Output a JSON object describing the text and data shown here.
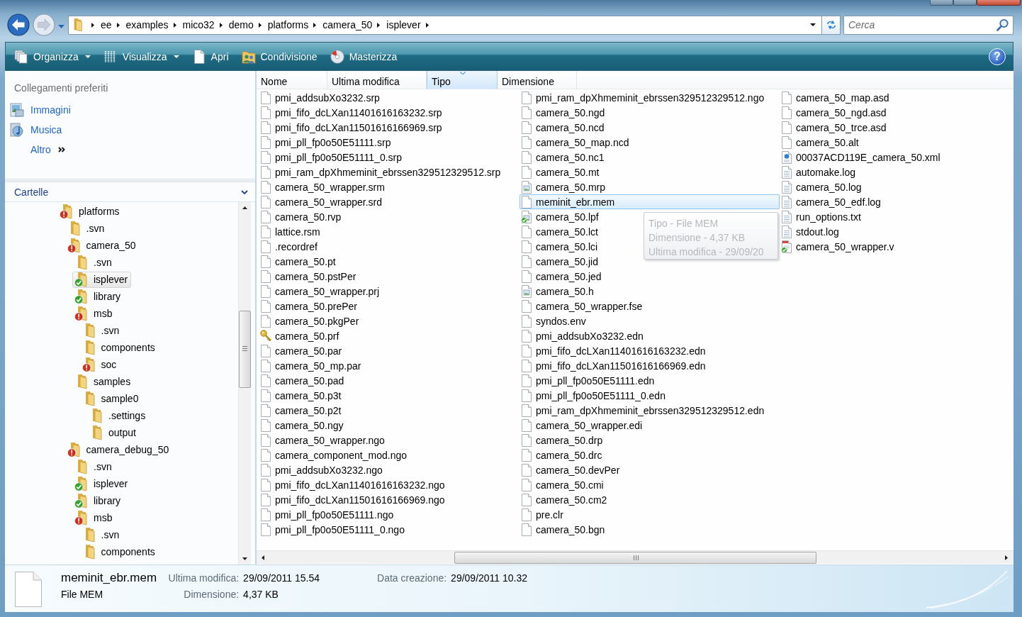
{
  "navigation": {
    "back": {
      "disabled": false
    },
    "forward": {
      "disabled": true
    },
    "breadcrumbs": [
      "ee",
      "examples",
      "mico32",
      "demo",
      "platforms",
      "camera_50",
      "isplever"
    ]
  },
  "search": {
    "placeholder": "Cerca"
  },
  "toolbar": {
    "items": [
      {
        "label": "Organizza",
        "kind": "menu"
      },
      {
        "label": "Visualizza",
        "kind": "menu"
      },
      {
        "label": "Apri",
        "kind": "button"
      },
      {
        "label": "Condivisione",
        "kind": "button"
      },
      {
        "label": "Masterizza",
        "kind": "button"
      }
    ],
    "help": "?"
  },
  "favorites": {
    "title": "Collegamenti preferiti",
    "links": [
      {
        "label": "Immagini",
        "kind": "link"
      },
      {
        "label": "Musica",
        "kind": "link"
      },
      {
        "label": "Altro",
        "kind": "more"
      }
    ]
  },
  "folders": {
    "title": "Cartelle",
    "tree": [
      {
        "name": "platforms",
        "kind": "conflict",
        "selected": false,
        "children": [
          {
            "name": ".svn",
            "kind": "plain",
            "selected": false
          },
          {
            "name": "camera_50",
            "kind": "conflict",
            "selected": false,
            "children": [
              {
                "name": ".svn",
                "kind": "plain",
                "selected": false
              },
              {
                "name": "isplever",
                "kind": "ok",
                "selected": true
              },
              {
                "name": "library",
                "kind": "ok",
                "selected": false
              },
              {
                "name": "msb",
                "kind": "conflict",
                "selected": false,
                "children": [
                  {
                    "name": ".svn",
                    "kind": "plain",
                    "selected": false
                  },
                  {
                    "name": "components",
                    "kind": "plain",
                    "selected": false
                  },
                  {
                    "name": "soc",
                    "kind": "conflict",
                    "selected": false
                  }
                ]
              },
              {
                "name": "samples",
                "kind": "plain",
                "selected": false,
                "children": [
                  {
                    "name": "sample0",
                    "kind": "plain",
                    "selected": false,
                    "children": [
                      {
                        "name": ".settings",
                        "kind": "plain",
                        "selected": false
                      },
                      {
                        "name": "output",
                        "kind": "plain",
                        "selected": false
                      }
                    ]
                  }
                ]
              }
            ]
          },
          {
            "name": "camera_debug_50",
            "kind": "conflict",
            "selected": false,
            "children": [
              {
                "name": ".svn",
                "kind": "plain",
                "selected": false
              },
              {
                "name": "isplever",
                "kind": "ok",
                "selected": false
              },
              {
                "name": "library",
                "kind": "ok",
                "selected": false
              },
              {
                "name": "msb",
                "kind": "conflict",
                "selected": false,
                "children": [
                  {
                    "name": ".svn",
                    "kind": "plain",
                    "selected": false
                  },
                  {
                    "name": "components",
                    "kind": "plain",
                    "selected": false
                  }
                ]
              }
            ]
          }
        ]
      }
    ]
  },
  "columns": [
    {
      "label": "Nome",
      "sorted": false
    },
    {
      "label": "Ultima modifica",
      "sorted": false
    },
    {
      "label": "Tipo",
      "sorted": true
    },
    {
      "label": "Dimensione",
      "sorted": false
    }
  ],
  "files": [
    {
      "name": "pmi_addsubXo3232.srp",
      "kind": "file",
      "selected": false
    },
    {
      "name": "pmi_fifo_dcLXan11401616163232.srp",
      "kind": "file",
      "selected": false
    },
    {
      "name": "pmi_fifo_dcLXan11501616166969.srp",
      "kind": "file",
      "selected": false
    },
    {
      "name": "pmi_pll_fp0o50E51111.srp",
      "kind": "file",
      "selected": false
    },
    {
      "name": "pmi_pll_fp0o50E51111_0.srp",
      "kind": "file",
      "selected": false
    },
    {
      "name": "pmi_ram_dpXhmeminit_ebrssen329512329512.srp",
      "kind": "file",
      "selected": false
    },
    {
      "name": "camera_50_wrapper.srm",
      "kind": "file",
      "selected": false
    },
    {
      "name": "camera_50_wrapper.srd",
      "kind": "file",
      "selected": false
    },
    {
      "name": "camera_50.rvp",
      "kind": "file",
      "selected": false
    },
    {
      "name": "lattice.rsm",
      "kind": "file",
      "selected": false
    },
    {
      "name": ".recordref",
      "kind": "file",
      "selected": false
    },
    {
      "name": "camera_50.pt",
      "kind": "file",
      "selected": false
    },
    {
      "name": "camera_50.pstPer",
      "kind": "file",
      "selected": false
    },
    {
      "name": "camera_50_wrapper.prj",
      "kind": "file",
      "selected": false
    },
    {
      "name": "camera_50.prePer",
      "kind": "file",
      "selected": false
    },
    {
      "name": "camera_50.pkgPer",
      "kind": "file",
      "selected": false
    },
    {
      "name": "camera_50.prf",
      "kind": "key",
      "selected": false
    },
    {
      "name": "camera_50.par",
      "kind": "file",
      "selected": false
    },
    {
      "name": "camera_50_mp.par",
      "kind": "file",
      "selected": false
    },
    {
      "name": "camera_50.pad",
      "kind": "file",
      "selected": false
    },
    {
      "name": "camera_50.p3t",
      "kind": "file",
      "selected": false
    },
    {
      "name": "camera_50.p2t",
      "kind": "file",
      "selected": false
    },
    {
      "name": "camera_50.ngy",
      "kind": "file",
      "selected": false
    },
    {
      "name": "camera_50_wrapper.ngo",
      "kind": "file",
      "selected": false
    },
    {
      "name": "camera_component_mod.ngo",
      "kind": "file",
      "selected": false
    },
    {
      "name": "pmi_addsubXo3232.ngo",
      "kind": "file",
      "selected": false
    },
    {
      "name": "pmi_fifo_dcLXan11401616163232.ngo",
      "kind": "file",
      "selected": false
    },
    {
      "name": "pmi_fifo_dcLXan11501616166969.ngo",
      "kind": "file",
      "selected": false
    },
    {
      "name": "pmi_pll_fp0o50E51111.ngo",
      "kind": "file",
      "selected": false
    },
    {
      "name": "pmi_pll_fp0o50E51111_0.ngo",
      "kind": "file",
      "selected": false
    },
    {
      "name": "pmi_ram_dpXhmeminit_ebrssen329512329512.ngo",
      "kind": "file",
      "selected": false
    },
    {
      "name": "camera_50.ngd",
      "kind": "file",
      "selected": false
    },
    {
      "name": "camera_50.ncd",
      "kind": "file",
      "selected": false
    },
    {
      "name": "camera_50_map.ncd",
      "kind": "file",
      "selected": false
    },
    {
      "name": "camera_50.nc1",
      "kind": "file",
      "selected": false
    },
    {
      "name": "camera_50.mt",
      "kind": "file",
      "selected": false
    },
    {
      "name": "camera_50.mrp",
      "kind": "image",
      "selected": false
    },
    {
      "name": "meminit_ebr.mem",
      "kind": "file",
      "selected": true
    },
    {
      "name": "camera_50.lpf",
      "kind": "imagecheck",
      "selected": false
    },
    {
      "name": "camera_50.lct",
      "kind": "file",
      "selected": false
    },
    {
      "name": "camera_50.lci",
      "kind": "file",
      "selected": false
    },
    {
      "name": "camera_50.jid",
      "kind": "file",
      "selected": false
    },
    {
      "name": "camera_50.jed",
      "kind": "file",
      "selected": false
    },
    {
      "name": "camera_50.h",
      "kind": "image",
      "selected": false
    },
    {
      "name": "camera_50_wrapper.fse",
      "kind": "file",
      "selected": false
    },
    {
      "name": "syndos.env",
      "kind": "file",
      "selected": false
    },
    {
      "name": "pmi_addsubXo3232.edn",
      "kind": "file",
      "selected": false
    },
    {
      "name": "pmi_fifo_dcLXan11401616163232.edn",
      "kind": "file",
      "selected": false
    },
    {
      "name": "pmi_fifo_dcLXan11501616166969.edn",
      "kind": "file",
      "selected": false
    },
    {
      "name": "pmi_pll_fp0o50E51111.edn",
      "kind": "file",
      "selected": false
    },
    {
      "name": "pmi_pll_fp0o50E51111_0.edn",
      "kind": "file",
      "selected": false
    },
    {
      "name": "pmi_ram_dpXhmeminit_ebrssen329512329512.edn",
      "kind": "file",
      "selected": false
    },
    {
      "name": "camera_50_wrapper.edi",
      "kind": "file",
      "selected": false
    },
    {
      "name": "camera_50.drp",
      "kind": "file",
      "selected": false
    },
    {
      "name": "camera_50.drc",
      "kind": "file",
      "selected": false
    },
    {
      "name": "camera_50.devPer",
      "kind": "file",
      "selected": false
    },
    {
      "name": "camera_50.cmi",
      "kind": "file",
      "selected": false
    },
    {
      "name": "camera_50.cm2",
      "kind": "file",
      "selected": false
    },
    {
      "name": "pre.clr",
      "kind": "file",
      "selected": false
    },
    {
      "name": "camera_50.bgn",
      "kind": "file",
      "selected": false
    },
    {
      "name": "camera_50_map.asd",
      "kind": "file",
      "selected": false
    },
    {
      "name": "camera_50_ngd.asd",
      "kind": "file",
      "selected": false
    },
    {
      "name": "camera_50_trce.asd",
      "kind": "file",
      "selected": false
    },
    {
      "name": "camera_50.alt",
      "kind": "file",
      "selected": false
    },
    {
      "name": "00037ACD119E_camera_50.xml",
      "kind": "xml",
      "selected": false
    },
    {
      "name": "automake.log",
      "kind": "text",
      "selected": false
    },
    {
      "name": "camera_50.log",
      "kind": "text",
      "selected": false
    },
    {
      "name": "camera_50_edf.log",
      "kind": "text",
      "selected": false
    },
    {
      "name": "run_options.txt",
      "kind": "text",
      "selected": false
    },
    {
      "name": "stdout.log",
      "kind": "text",
      "selected": false
    },
    {
      "name": "camera_50_wrapper.v",
      "kind": "codecheck",
      "selected": false
    }
  ],
  "tooltip": {
    "lines": [
      "Tipo - File MEM",
      "Dimensione - 4,37 KB",
      "Ultima modifica - 29/09/20"
    ]
  },
  "details": {
    "name": "meminit_ebr.mem",
    "type": "File MEM",
    "fields": [
      {
        "label": "Ultima modifica:",
        "value": "29/09/2011 15.54"
      },
      {
        "label": "Dimensione:",
        "value": "4,37 KB"
      },
      {
        "label": "Data creazione:",
        "value": "29/09/2011 10.32"
      }
    ]
  }
}
